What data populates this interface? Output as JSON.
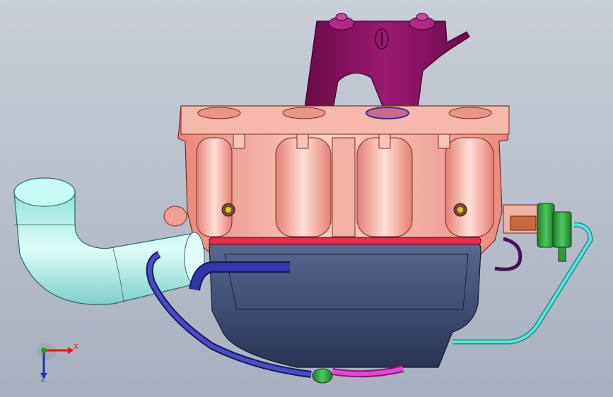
{
  "viewport": {
    "background_top": "#c9ced8",
    "background_bottom": "#a8b0bf"
  },
  "model": {
    "parts": [
      {
        "name": "mounting-bracket",
        "color": "#8a1060"
      },
      {
        "name": "intake-manifold",
        "color": "#f2a79c"
      },
      {
        "name": "throttle-elbow-pipe",
        "color": "#b6f2ec"
      },
      {
        "name": "resonator-box",
        "color": "#3b4a6e"
      },
      {
        "name": "breather-hose",
        "color": "#2c2f86"
      },
      {
        "name": "coolant-line",
        "color": "#38c6c0"
      },
      {
        "name": "sensor-connector",
        "color": "#2f9b3a"
      },
      {
        "name": "vacuum-hose",
        "color": "#d832b8"
      }
    ]
  },
  "triad": {
    "x_label": "X",
    "z_label": "Z",
    "x_color": "#e01818",
    "y_color": "#18a018",
    "z_color": "#2030c0"
  }
}
